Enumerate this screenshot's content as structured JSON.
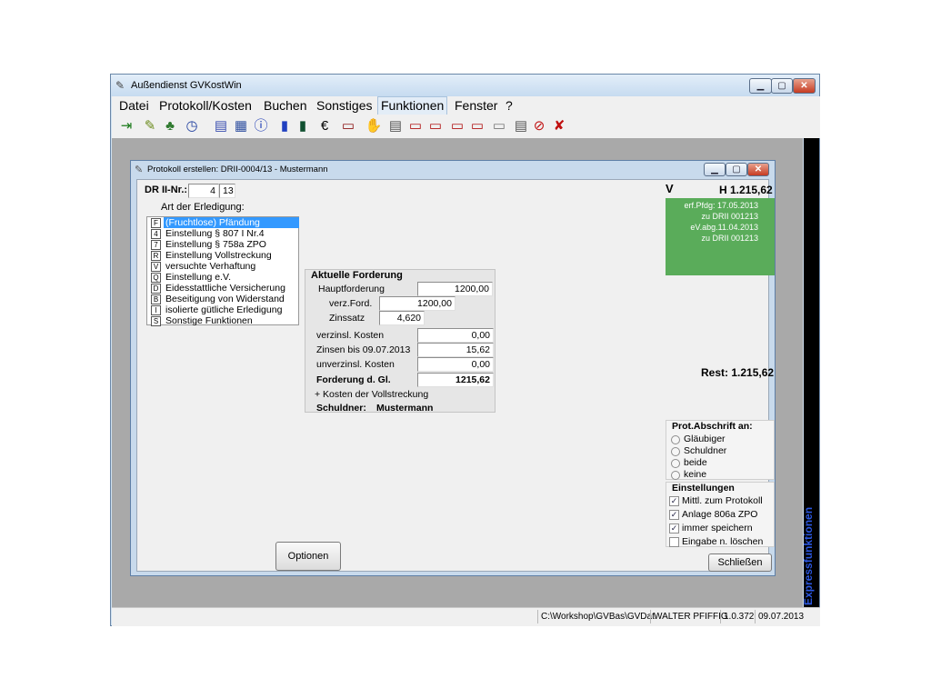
{
  "window": {
    "title": "Außendienst GVKostWin",
    "controls": {
      "minimize": "▁",
      "maximize": "▢",
      "close": "✕"
    }
  },
  "menu": [
    "Datei",
    "Protokoll/Kosten",
    "Buchen",
    "Sonstiges",
    "Funktionen",
    "Fenster",
    "?"
  ],
  "toolbar": [
    {
      "icon": "exit-icon",
      "glyph": "⇥",
      "color": "#1a7a1a"
    },
    {
      "icon": "edit-pencil-icon",
      "glyph": "✎",
      "color": "#6a8a1a"
    },
    {
      "icon": "tree-icon",
      "glyph": "♣",
      "color": "#2f7a2f"
    },
    {
      "icon": "clock-icon",
      "glyph": "◷",
      "color": "#1f3f9f"
    },
    {
      "icon": "calculator-icon",
      "glyph": "▤",
      "color": "#3b4fb0"
    },
    {
      "icon": "calendar-icon",
      "glyph": "▦",
      "color": "#3050a0"
    },
    {
      "icon": "info-icon",
      "glyph": "ⓘ",
      "color": "#1030b0"
    },
    {
      "icon": "book-icon",
      "glyph": "▮",
      "color": "#2040c0"
    },
    {
      "icon": "books-icon",
      "glyph": "▮",
      "color": "#105030"
    },
    {
      "icon": "euro-icon",
      "glyph": "€",
      "color": "#000000"
    },
    {
      "icon": "document-t-icon",
      "glyph": "▭",
      "color": "#8a1010"
    },
    {
      "icon": "handshake-icon",
      "glyph": "✋",
      "color": "#b07020"
    },
    {
      "icon": "document-list-icon",
      "glyph": "▤",
      "color": "#555555"
    },
    {
      "icon": "calendar-18-icon",
      "glyph": "▭",
      "color": "#b01010"
    },
    {
      "icon": "va-icon",
      "glyph": "▭",
      "color": "#b01010"
    },
    {
      "icon": "hb-icon",
      "glyph": "▭",
      "color": "#b01010"
    },
    {
      "icon": "zu-icon",
      "glyph": "▭",
      "color": "#b01010"
    },
    {
      "icon": "number-icon",
      "glyph": "▭",
      "color": "#777777"
    },
    {
      "icon": "document-grid-icon",
      "glyph": "▤",
      "color": "#555555"
    },
    {
      "icon": "no-entry-icon",
      "glyph": "⊘",
      "color": "#c01010"
    },
    {
      "icon": "cancel-icon",
      "glyph": "✘",
      "color": "#c01010"
    }
  ],
  "express": {
    "label": "Expressfunktionen"
  },
  "status": {
    "path": "C:\\Workshop\\GVBas\\GVDat",
    "user": "WALTER PFIFFIG",
    "version": "1.0.372",
    "date": "09.07.2013"
  },
  "dialog": {
    "title": "Protokoll erstellen: DRII-0004/13 - Mustermann",
    "dr_label": "DR II-Nr.:",
    "dr_number": "4",
    "dr_year": "13",
    "erledigung_label": "Art der Erledigung:",
    "erledigung_items": [
      {
        "key": "F",
        "text": "(Fruchtlose) Pfändung"
      },
      {
        "key": "4",
        "text": "Einstellung § 807 I Nr.4"
      },
      {
        "key": "7",
        "text": "Einstellung § 758a ZPO"
      },
      {
        "key": "R",
        "text": "Einstellung Vollstreckung"
      },
      {
        "key": "V",
        "text": "versuchte Verhaftung"
      },
      {
        "key": "Q",
        "text": "Einstellung e.V."
      },
      {
        "key": "D",
        "text": "Eidesstattliche Versicherung"
      },
      {
        "key": "B",
        "text": "Beseitigung von Widerstand"
      },
      {
        "key": "I",
        "text": "isolierte gütliche Erledigung"
      },
      {
        "key": "S",
        "text": "Sonstige Funktionen"
      }
    ],
    "forderung": {
      "title": "Aktuelle Forderung",
      "hauptforderung_label": "Hauptforderung",
      "hauptforderung": "1200,00",
      "verz_ford_label": "verz.Ford.",
      "verz_ford": "1200,00",
      "zinssatz_label": "Zinssatz",
      "zinssatz": "4,620",
      "verzinsl_kosten_label": "verzinsl. Kosten",
      "verzinsl_kosten": "0,00",
      "zinsen_label": "Zinsen bis 09.07.2013",
      "zinsen": "15,62",
      "unverzinsl_kosten_label": "unverzinsl. Kosten",
      "unverzinsl_kosten": "0,00",
      "forderung_gl_label": "Forderung d. Gl.",
      "forderung_gl": "1215,62",
      "kosten_note": "+ Kosten der Vollstreckung",
      "schuldner_label": "Schuldner:",
      "schuldner": "Mustermann"
    },
    "v_label": "V",
    "h_amount": "H 1.215,62",
    "green_lines": [
      "erf.Pfdg: 17.05.2013",
      "zu DRII 001213",
      "eV.abg.11.04.2013",
      "zu DRII 001213"
    ],
    "rest": "Rest: 1.215,62",
    "abschrift": {
      "title": "Prot.Abschrift an:",
      "options": [
        "Gläubiger",
        "Schuldner",
        "beide",
        "keine"
      ]
    },
    "einstellungen": {
      "title": "Einstellungen",
      "items": [
        {
          "label": "Mittl. zum Protokoll",
          "checked": true
        },
        {
          "label": "Anlage 806a ZPO",
          "checked": true
        },
        {
          "label": "immer speichern",
          "checked": true
        },
        {
          "label": "Eingabe n. löschen",
          "checked": false
        }
      ]
    },
    "optionen_button": "Optionen",
    "schliessen_button": "Schließen"
  }
}
